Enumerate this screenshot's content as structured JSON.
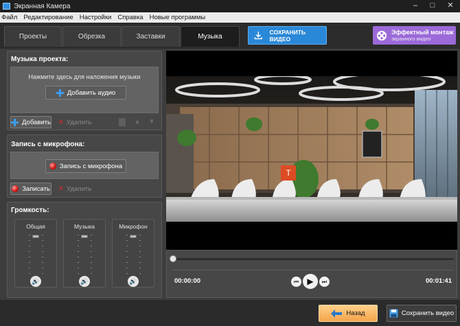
{
  "window": {
    "title": "Экранная Камера",
    "minimize": "–",
    "maximize": "□",
    "close": "✕"
  },
  "menu": [
    "Файл",
    "Редактирование",
    "Настройки",
    "Справка",
    "Новые программы"
  ],
  "tabs": [
    {
      "label": "Проекты",
      "active": false
    },
    {
      "label": "Обрезка",
      "active": false
    },
    {
      "label": "Заставки",
      "active": false
    },
    {
      "label": "Музыка",
      "active": true
    }
  ],
  "save_video_label": "СОХРАНИТЬ ВИДЕО",
  "promo": {
    "title": "Эффектный монтаж",
    "subtitle": "экранного видео"
  },
  "music": {
    "title": "Музыка проекта:",
    "hint": "Нажмите здесь для наложения музыки",
    "add_audio": "Добавить аудио",
    "add": "Добавить",
    "delete": "Удалить"
  },
  "mic": {
    "title": "Запись с микрофона:",
    "record_from_mic": "Запись с микрофона",
    "record": "Записать",
    "delete": "Удалить"
  },
  "volume": {
    "title": "Громкость:",
    "channels": [
      {
        "label": "Общая",
        "level": 1.0
      },
      {
        "label": "Музыка",
        "level": 1.0
      },
      {
        "label": "Микрофон",
        "level": 1.0
      }
    ]
  },
  "player": {
    "current_time": "00:00:00",
    "total_time": "00:01:41",
    "progress": 0.0
  },
  "bottom": {
    "back": "Назад",
    "save": "Сохранить видео"
  },
  "colors": {
    "accent_blue": "#2a88d8",
    "promo_purple": "#9b6ad8",
    "back_orange": "#f5a44a"
  },
  "icons": {
    "title_label": "T",
    "play": "▶",
    "prev": "⏮",
    "next": "⏭",
    "speaker": "🔊",
    "back_arrow": "⬅"
  }
}
